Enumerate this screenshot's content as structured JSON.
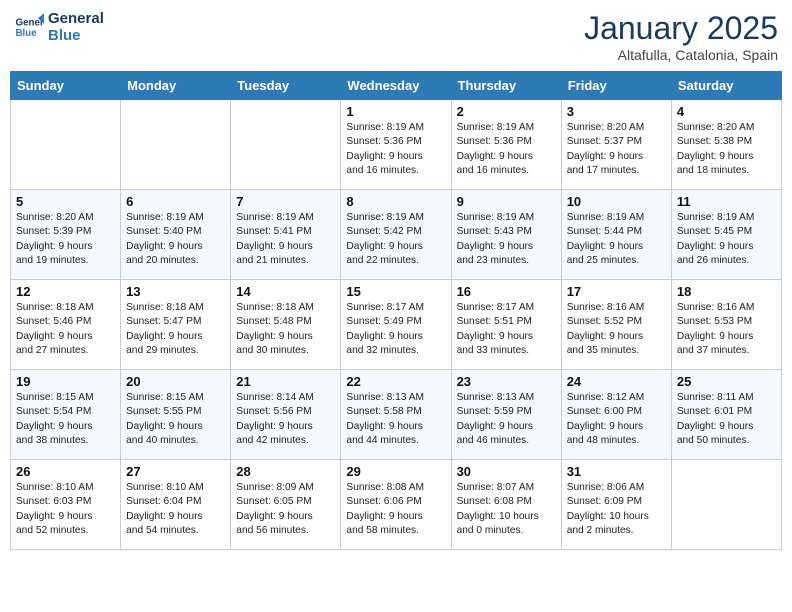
{
  "logo": {
    "line1": "General",
    "line2": "Blue"
  },
  "header": {
    "month": "January 2025",
    "location": "Altafulla, Catalonia, Spain"
  },
  "weekdays": [
    "Sunday",
    "Monday",
    "Tuesday",
    "Wednesday",
    "Thursday",
    "Friday",
    "Saturday"
  ],
  "weeks": [
    [
      {
        "day": "",
        "info": ""
      },
      {
        "day": "",
        "info": ""
      },
      {
        "day": "",
        "info": ""
      },
      {
        "day": "1",
        "info": "Sunrise: 8:19 AM\nSunset: 5:36 PM\nDaylight: 9 hours\nand 16 minutes."
      },
      {
        "day": "2",
        "info": "Sunrise: 8:19 AM\nSunset: 5:36 PM\nDaylight: 9 hours\nand 16 minutes."
      },
      {
        "day": "3",
        "info": "Sunrise: 8:20 AM\nSunset: 5:37 PM\nDaylight: 9 hours\nand 17 minutes."
      },
      {
        "day": "4",
        "info": "Sunrise: 8:20 AM\nSunset: 5:38 PM\nDaylight: 9 hours\nand 18 minutes."
      }
    ],
    [
      {
        "day": "5",
        "info": "Sunrise: 8:20 AM\nSunset: 5:39 PM\nDaylight: 9 hours\nand 19 minutes."
      },
      {
        "day": "6",
        "info": "Sunrise: 8:19 AM\nSunset: 5:40 PM\nDaylight: 9 hours\nand 20 minutes."
      },
      {
        "day": "7",
        "info": "Sunrise: 8:19 AM\nSunset: 5:41 PM\nDaylight: 9 hours\nand 21 minutes."
      },
      {
        "day": "8",
        "info": "Sunrise: 8:19 AM\nSunset: 5:42 PM\nDaylight: 9 hours\nand 22 minutes."
      },
      {
        "day": "9",
        "info": "Sunrise: 8:19 AM\nSunset: 5:43 PM\nDaylight: 9 hours\nand 23 minutes."
      },
      {
        "day": "10",
        "info": "Sunrise: 8:19 AM\nSunset: 5:44 PM\nDaylight: 9 hours\nand 25 minutes."
      },
      {
        "day": "11",
        "info": "Sunrise: 8:19 AM\nSunset: 5:45 PM\nDaylight: 9 hours\nand 26 minutes."
      }
    ],
    [
      {
        "day": "12",
        "info": "Sunrise: 8:18 AM\nSunset: 5:46 PM\nDaylight: 9 hours\nand 27 minutes."
      },
      {
        "day": "13",
        "info": "Sunrise: 8:18 AM\nSunset: 5:47 PM\nDaylight: 9 hours\nand 29 minutes."
      },
      {
        "day": "14",
        "info": "Sunrise: 8:18 AM\nSunset: 5:48 PM\nDaylight: 9 hours\nand 30 minutes."
      },
      {
        "day": "15",
        "info": "Sunrise: 8:17 AM\nSunset: 5:49 PM\nDaylight: 9 hours\nand 32 minutes."
      },
      {
        "day": "16",
        "info": "Sunrise: 8:17 AM\nSunset: 5:51 PM\nDaylight: 9 hours\nand 33 minutes."
      },
      {
        "day": "17",
        "info": "Sunrise: 8:16 AM\nSunset: 5:52 PM\nDaylight: 9 hours\nand 35 minutes."
      },
      {
        "day": "18",
        "info": "Sunrise: 8:16 AM\nSunset: 5:53 PM\nDaylight: 9 hours\nand 37 minutes."
      }
    ],
    [
      {
        "day": "19",
        "info": "Sunrise: 8:15 AM\nSunset: 5:54 PM\nDaylight: 9 hours\nand 38 minutes."
      },
      {
        "day": "20",
        "info": "Sunrise: 8:15 AM\nSunset: 5:55 PM\nDaylight: 9 hours\nand 40 minutes."
      },
      {
        "day": "21",
        "info": "Sunrise: 8:14 AM\nSunset: 5:56 PM\nDaylight: 9 hours\nand 42 minutes."
      },
      {
        "day": "22",
        "info": "Sunrise: 8:13 AM\nSunset: 5:58 PM\nDaylight: 9 hours\nand 44 minutes."
      },
      {
        "day": "23",
        "info": "Sunrise: 8:13 AM\nSunset: 5:59 PM\nDaylight: 9 hours\nand 46 minutes."
      },
      {
        "day": "24",
        "info": "Sunrise: 8:12 AM\nSunset: 6:00 PM\nDaylight: 9 hours\nand 48 minutes."
      },
      {
        "day": "25",
        "info": "Sunrise: 8:11 AM\nSunset: 6:01 PM\nDaylight: 9 hours\nand 50 minutes."
      }
    ],
    [
      {
        "day": "26",
        "info": "Sunrise: 8:10 AM\nSunset: 6:03 PM\nDaylight: 9 hours\nand 52 minutes."
      },
      {
        "day": "27",
        "info": "Sunrise: 8:10 AM\nSunset: 6:04 PM\nDaylight: 9 hours\nand 54 minutes."
      },
      {
        "day": "28",
        "info": "Sunrise: 8:09 AM\nSunset: 6:05 PM\nDaylight: 9 hours\nand 56 minutes."
      },
      {
        "day": "29",
        "info": "Sunrise: 8:08 AM\nSunset: 6:06 PM\nDaylight: 9 hours\nand 58 minutes."
      },
      {
        "day": "30",
        "info": "Sunrise: 8:07 AM\nSunset: 6:08 PM\nDaylight: 10 hours\nand 0 minutes."
      },
      {
        "day": "31",
        "info": "Sunrise: 8:06 AM\nSunset: 6:09 PM\nDaylight: 10 hours\nand 2 minutes."
      },
      {
        "day": "",
        "info": ""
      }
    ]
  ]
}
